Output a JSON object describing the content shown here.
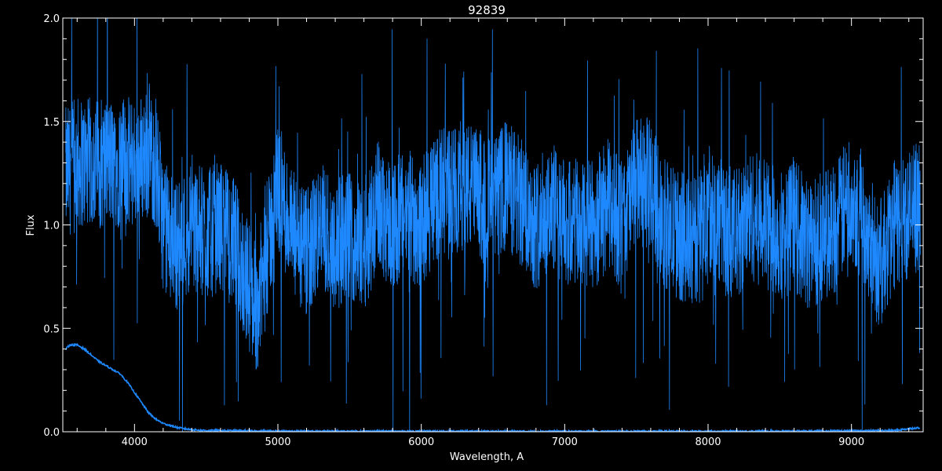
{
  "chart_data": {
    "type": "line",
    "title": "92839",
    "xlabel": "Wavelength, A",
    "ylabel": "Flux",
    "xlim": [
      3500,
      9500
    ],
    "ylim": [
      0.0,
      2.0
    ],
    "x_ticks": [
      4000,
      5000,
      6000,
      7000,
      8000,
      9000
    ],
    "x_tick_labels": [
      "4000",
      "5000",
      "6000",
      "7000",
      "8000",
      "9000"
    ],
    "y_ticks": [
      0.0,
      0.5,
      1.0,
      1.5,
      2.0
    ],
    "y_tick_labels": [
      "0.0",
      "0.5",
      "1.0",
      "1.5",
      "2.0"
    ],
    "grid": false,
    "series": [
      {
        "color": "#1e88ff",
        "x": [
          3520,
          3600,
          3700,
          3800,
          3900,
          4000,
          4100,
          4150,
          4200,
          4300,
          4400,
          4500,
          4600,
          4700,
          4800,
          4850,
          4900,
          5000,
          5100,
          5200,
          5300,
          5400,
          5500,
          5600,
          5700,
          5800,
          5900,
          6000,
          6100,
          6200,
          6300,
          6400,
          6500,
          6600,
          6700,
          6800,
          6900,
          7000,
          7100,
          7200,
          7300,
          7400,
          7500,
          7600,
          7700,
          7800,
          7900,
          8000,
          8100,
          8200,
          8300,
          8400,
          8500,
          8600,
          8700,
          8800,
          8900,
          9000,
          9100,
          9200,
          9300,
          9400,
          9480
        ],
        "y": [
          1.25,
          1.3,
          1.3,
          1.3,
          1.3,
          1.3,
          1.35,
          1.3,
          1.0,
          0.9,
          1.0,
          0.95,
          1.0,
          0.9,
          0.7,
          0.6,
          0.75,
          1.2,
          0.95,
          0.85,
          1.0,
          0.9,
          0.95,
          0.9,
          1.1,
          1.0,
          1.05,
          1.0,
          1.15,
          1.15,
          1.2,
          1.15,
          1.1,
          1.2,
          1.1,
          1.0,
          1.1,
          1.0,
          1.0,
          1.0,
          1.1,
          1.0,
          1.2,
          1.2,
          1.0,
          0.95,
          0.9,
          1.1,
          1.0,
          0.95,
          1.05,
          1.0,
          0.95,
          1.0,
          0.9,
          0.95,
          1.0,
          1.15,
          1.0,
          0.8,
          1.0,
          1.05,
          1.1
        ]
      },
      {
        "color": "#1e88ff",
        "x": [
          3520,
          3550,
          3600,
          3650,
          3700,
          3750,
          3800,
          3850,
          3900,
          3950,
          4000,
          4050,
          4100,
          4150,
          4200,
          4250,
          4300,
          4400,
          4500,
          5000,
          6000,
          7000,
          8000,
          9000,
          9300,
          9400,
          9480
        ],
        "y": [
          0.4,
          0.42,
          0.42,
          0.4,
          0.37,
          0.34,
          0.32,
          0.3,
          0.28,
          0.24,
          0.19,
          0.14,
          0.09,
          0.06,
          0.04,
          0.03,
          0.02,
          0.01,
          0.006,
          0.003,
          0.002,
          0.002,
          0.002,
          0.004,
          0.006,
          0.015,
          0.02
        ]
      }
    ]
  }
}
